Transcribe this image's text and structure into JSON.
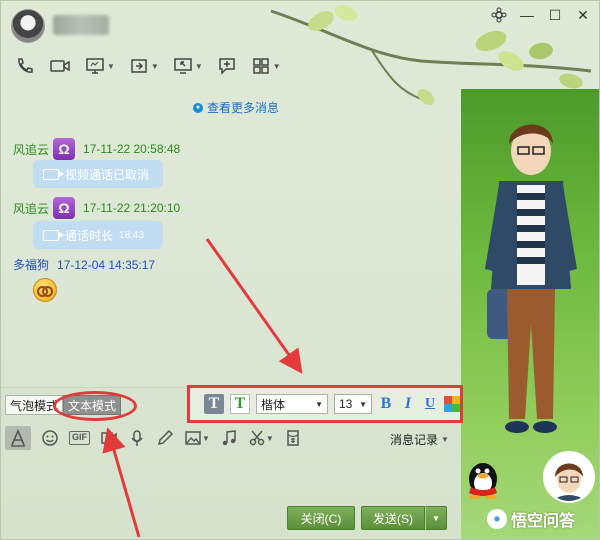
{
  "window": {
    "contact_name": "",
    "controls": {
      "settings": "✿",
      "minimize": "—",
      "maximize": "☐",
      "close": "✕"
    }
  },
  "toolbar_top": {
    "icons": [
      "phone-icon",
      "video-icon",
      "screen-share-icon",
      "file-transfer-icon",
      "remote-assist-icon",
      "new-chat-icon",
      "apps-grid-icon"
    ]
  },
  "chat": {
    "more_messages": "查看更多消息",
    "messages": [
      {
        "sender": "风追云",
        "badge": "Ω",
        "time": "17-11-22 20:58:48",
        "bubble_text": "视频通话已取消"
      },
      {
        "sender": "风追云",
        "badge": "Ω",
        "time": "17-11-22 21:20:10",
        "bubble_text": "通话时长",
        "bubble_extra": "18:43"
      },
      {
        "sender": "多福狗",
        "time": "17-12-04 14:35:17",
        "emoji": "dizzy-face-emoji"
      }
    ]
  },
  "input_mode": {
    "bubble_mode": "气泡模式",
    "text_mode": "文本模式",
    "active": "text_mode"
  },
  "font_bar": {
    "font_family": "楷体",
    "font_size": "13",
    "bold": "B",
    "italic": "I",
    "underline": "U",
    "text_style_a": "T",
    "text_style_b": "T"
  },
  "input_toolbar": {
    "gif": "GIF",
    "chat_history": "消息记录"
  },
  "buttons": {
    "close": "关闭(C)",
    "send": "发送(S)"
  },
  "watermark": {
    "text": "悟空问答"
  },
  "colors": {
    "sender_green": "#2b8a1e",
    "sender_blue": "#2152b8",
    "annotation_red": "#e23b3b",
    "button_green": "#6a9c47",
    "link_blue": "#1a6fc4"
  }
}
